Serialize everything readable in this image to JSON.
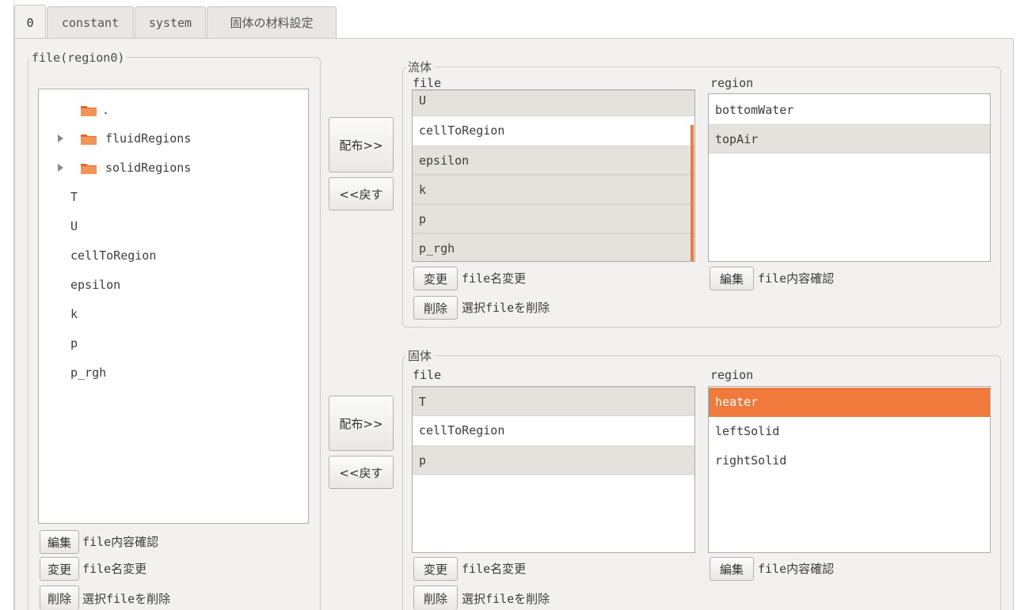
{
  "tabs": [
    {
      "label": "0"
    },
    {
      "label": "constant"
    },
    {
      "label": "system"
    },
    {
      "label": "固体の材料設定"
    }
  ],
  "left_panel": {
    "frame_label": "file(region0)",
    "tree": [
      {
        "label": ".",
        "type": "folder",
        "expandable": false
      },
      {
        "label": "fluidRegions",
        "type": "folder",
        "expandable": true
      },
      {
        "label": "solidRegions",
        "type": "folder",
        "expandable": true
      },
      {
        "label": "T",
        "type": "file"
      },
      {
        "label": "U",
        "type": "file"
      },
      {
        "label": "cellToRegion",
        "type": "file"
      },
      {
        "label": "epsilon",
        "type": "file"
      },
      {
        "label": "k",
        "type": "file"
      },
      {
        "label": "p",
        "type": "file"
      },
      {
        "label": "p_rgh",
        "type": "file"
      }
    ],
    "edit_button": "編集",
    "edit_caption": "file内容確認",
    "rename_button": "変更",
    "rename_caption": "file名変更",
    "delete_button": "削除",
    "delete_caption": "選択fileを削除"
  },
  "fluid": {
    "distribute_button": "配布>>",
    "return_button": "<<戻す",
    "frame_label": "流体",
    "file_header": "file",
    "region_header": "region",
    "files": [
      "U",
      "cellToRegion",
      "epsilon",
      "k",
      "p",
      "p_rgh"
    ],
    "regions": [
      "bottomWater",
      "topAir"
    ],
    "rename_button": "変更",
    "rename_caption": "file名変更",
    "delete_button": "削除",
    "delete_caption": "選択fileを削除",
    "edit_button": "編集",
    "edit_caption": "file内容確認"
  },
  "solid": {
    "distribute_button": "配布>>",
    "return_button": "<<戻す",
    "frame_label": "固体",
    "file_header": "file",
    "region_header": "region",
    "files": [
      "T",
      "cellToRegion",
      "p"
    ],
    "regions": [
      "heater",
      "leftSolid",
      "rightSolid"
    ],
    "rename_button": "変更",
    "rename_caption": "file名変更",
    "delete_button": "削除",
    "delete_caption": "選択fileを削除",
    "edit_button": "編集",
    "edit_caption": "file内容確認"
  },
  "colors": {
    "accent": "#f07a3c",
    "selection": "#e4e2dd",
    "background": "#f2f1ef"
  },
  "icons": {
    "folder": "folder-icon",
    "expander": "expander-arrow-icon"
  }
}
